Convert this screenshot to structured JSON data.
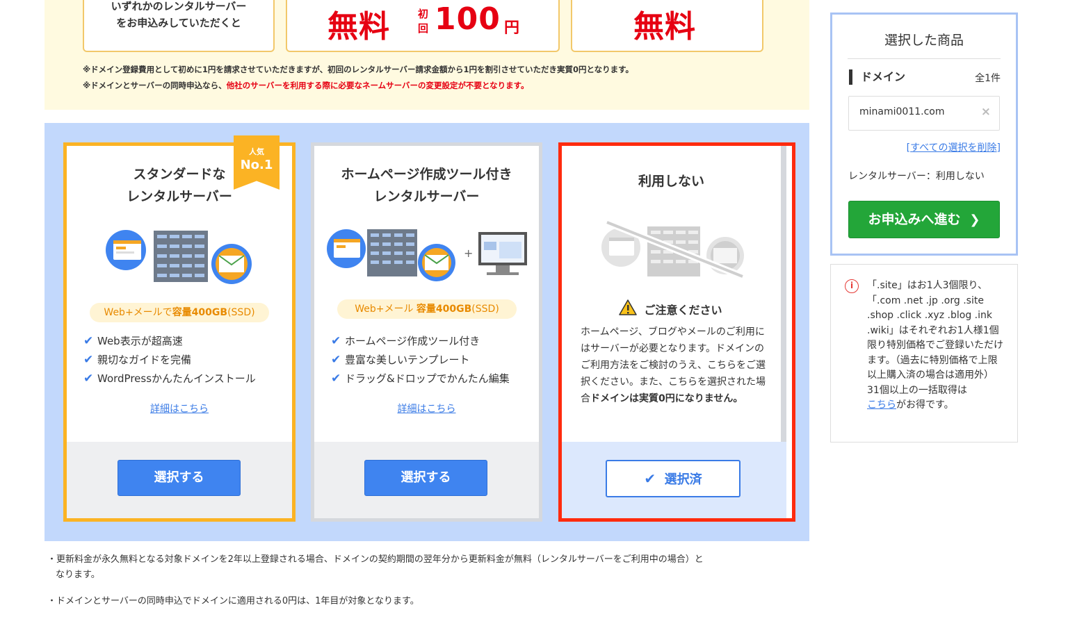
{
  "promo": {
    "box1_line1": "いずれかのレンタルサーバー",
    "box1_line2": "をお申込みしていただくと",
    "box2_free": "無料",
    "box2_first_top": "初",
    "box2_first_bottom": "回",
    "box2_price": "100",
    "box2_yen": "円",
    "box3_free": "無料",
    "note1": "※ドメイン登録費用として初めに1円を請求させていただきますが、初回のレンタルサーバー請求金額から1円を割引させていただき実質0円となります。",
    "note2_a": "※ドメインとサーバーの同時申込なら、",
    "note2_red": "他社のサーバーを利用する際に必要なネームサーバーの変更設定が不要となります。"
  },
  "plans": [
    {
      "title_line1": "スタンダードな",
      "title_line2": "レンタルサーバー",
      "badge_top": "人気",
      "badge_main": "No.1",
      "pill_a": "Web+メールで",
      "pill_b": "容量400GB",
      "pill_c": "(SSD)",
      "features": [
        "Web表示が超高速",
        "親切なガイドを完備",
        "WordPressかんたんインストール"
      ],
      "detail_link": "詳細はこちら",
      "button": "選択する"
    },
    {
      "title_line1": "ホームページ作成ツール付き",
      "title_line2": "レンタルサーバー",
      "pill_a": "Web+メール ",
      "pill_b": "容量400GB",
      "pill_c": "(SSD)",
      "features": [
        "ホームページ作成ツール付き",
        "豊富な美しいテンプレート",
        "ドラッグ&ドロップでかんたん編集"
      ],
      "detail_link": "詳細はこちら",
      "button": "選択する"
    },
    {
      "title": "利用しない",
      "warning_title": "ご注意ください",
      "warning_text": "ホームページ、ブログやメールのご利用にはサーバーが必要となります。ドメインのご利用方法をご検討のうえ、こちらをご選択ください。また、こちらを選択された場合",
      "warning_bold": "ドメインは実質0円になりません。",
      "button": "選択済"
    }
  ],
  "footnotes": [
    "・更新料金が永久無料となる対象ドメインを2年以上登録される場合、ドメインの契約期間の翌年分から更新料金が無料（レンタルサーバーをご利用中の場合）と",
    "なります。",
    "・ドメインとサーバーの同時申込でドメインに適用される0円は、1年目が対象となります。"
  ],
  "panel": {
    "title": "選択した商品",
    "domain_label": "ドメイン",
    "domain_count": "全1件",
    "domain_name": "minami0011.com",
    "remove_icon": "×",
    "clear_all": "すべての選択を削除",
    "server_status": "レンタルサーバー：利用しない",
    "proceed_button": "お申込みへ進む"
  },
  "info": {
    "text": "「.site」はお1人3個限り、「.com .net .jp .org .site .shop .click .xyz .blog .ink .wiki」はそれぞれお1人様1個限り特別価格でご登録いただけます。（過去に特別価格で上限以上購入済の場合は適用外）",
    "text2": "31個以上の一括取得は",
    "link": "こちら",
    "text3": "がお得です。"
  },
  "colors": {
    "accent_blue": "#3f84f0",
    "green": "#23a639",
    "red": "#e60012",
    "yellow": "#fbb324"
  }
}
